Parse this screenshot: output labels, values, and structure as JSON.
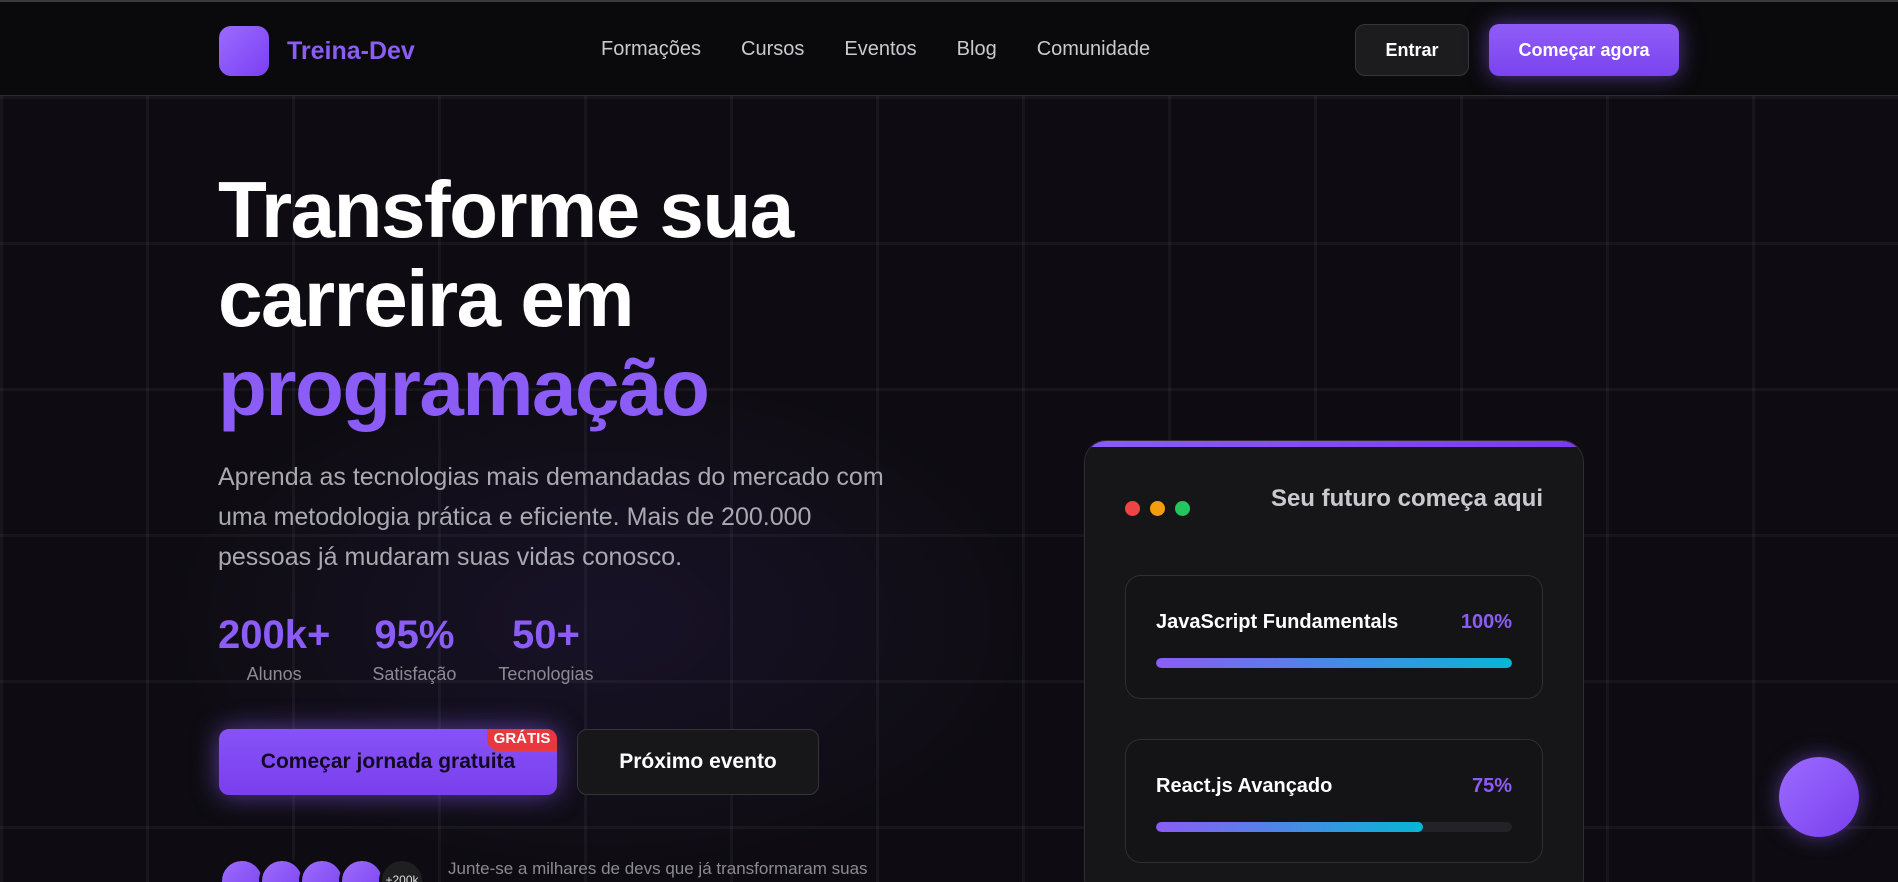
{
  "brand": {
    "name": "Treina-Dev"
  },
  "nav": {
    "items": [
      "Formações",
      "Cursos",
      "Eventos",
      "Blog",
      "Comunidade"
    ]
  },
  "header": {
    "login_label": "Entrar",
    "cta_label": "Começar agora"
  },
  "hero": {
    "title_line1": "Transforme sua",
    "title_line2": "carreira em",
    "title_accent": "programação",
    "subtitle": "Aprenda as tecnologias mais demandadas do mercado com uma metodologia prática e eficiente. Mais de 200.000 pessoas já mudaram suas vidas conosco.",
    "stats": [
      {
        "value": "200k+",
        "label": "Alunos"
      },
      {
        "value": "95%",
        "label": "Satisfação"
      },
      {
        "value": "50+",
        "label": "Tecnologias"
      }
    ],
    "primary_button": "Começar jornada gratuita",
    "primary_badge": "GRÁTIS",
    "secondary_button": "Próximo evento",
    "avatar_count": "+200k",
    "join_text": "Junte-se a milhares de devs que já transformaram suas"
  },
  "progress_card": {
    "title": "Seu futuro começa aqui",
    "courses": [
      {
        "name": "JavaScript Fundamentals",
        "percent_label": "100%",
        "progress": 1.0
      },
      {
        "name": "React.js Avançado",
        "percent_label": "75%",
        "progress": 0.75
      }
    ]
  },
  "colors": {
    "accent": "#8b5cf6",
    "dot_red": "#ef4444",
    "dot_yellow": "#f59e0b",
    "dot_green": "#22c55e"
  }
}
